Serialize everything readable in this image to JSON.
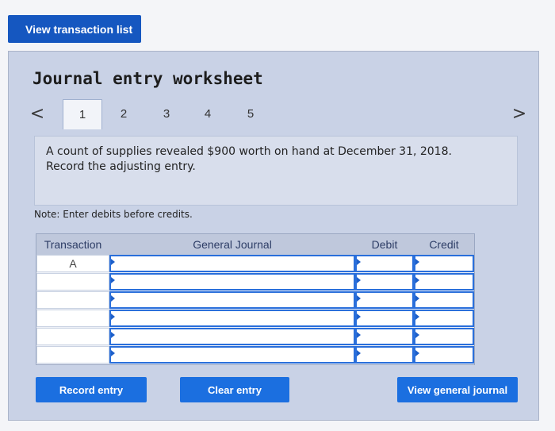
{
  "top_button": {
    "label": "View transaction list"
  },
  "worksheet": {
    "title": "Journal entry worksheet",
    "nav": {
      "prev_icon": "chevron-left-icon",
      "prev_glyph": "<",
      "next_icon": "chevron-right-icon",
      "next_glyph": ">"
    },
    "tabs": [
      "1",
      "2",
      "3",
      "4",
      "5"
    ],
    "active_tab": "1",
    "question_line1": "A count of supplies revealed $900 worth on hand at December 31, 2018.",
    "question_line2": "Record the adjusting entry.",
    "note": "Note: Enter debits before credits."
  },
  "table": {
    "headers": {
      "transaction": "Transaction",
      "journal": "General Journal",
      "debit": "Debit",
      "credit": "Credit"
    },
    "rows": [
      {
        "transaction": "A"
      },
      {
        "transaction": ""
      },
      {
        "transaction": ""
      },
      {
        "transaction": ""
      },
      {
        "transaction": ""
      },
      {
        "transaction": ""
      }
    ]
  },
  "buttons": {
    "record": "Record entry",
    "clear": "Clear entry",
    "view_journal": "View general journal"
  },
  "colors": {
    "primary_blue": "#1b6fe0",
    "input_border": "#2a6fdb",
    "panel": "#c9d2e6"
  }
}
